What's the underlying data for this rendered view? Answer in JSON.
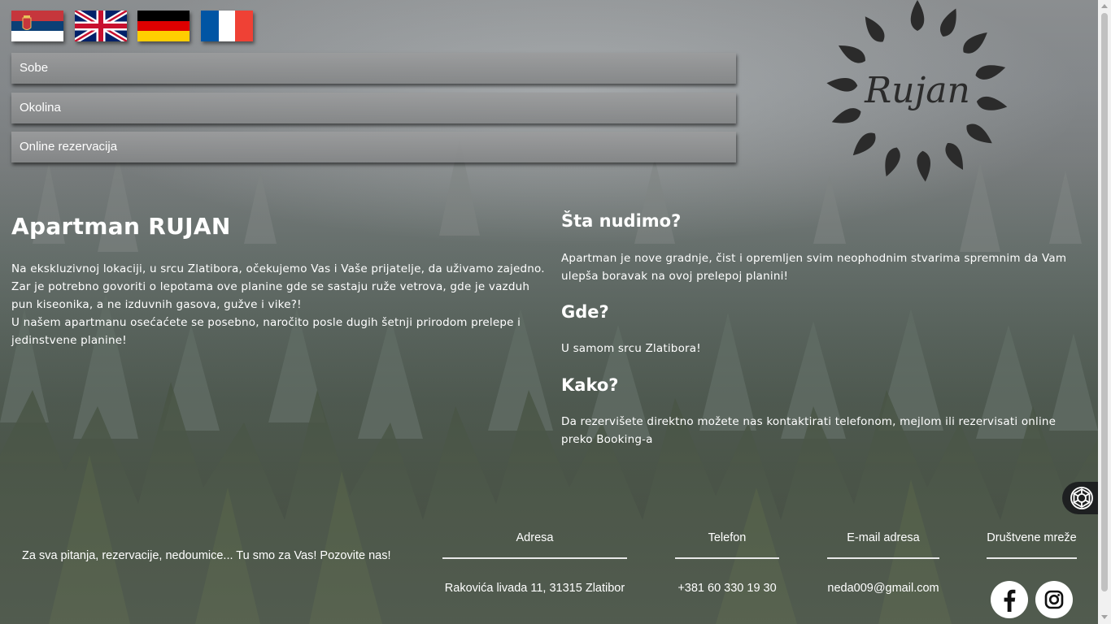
{
  "languages": [
    {
      "code": "sr",
      "label": "Srpski"
    },
    {
      "code": "en",
      "label": "English"
    },
    {
      "code": "de",
      "label": "Deutsch"
    },
    {
      "code": "fr",
      "label": "Français"
    }
  ],
  "menu": {
    "items": [
      {
        "label": "Sobe"
      },
      {
        "label": "Okolina"
      },
      {
        "label": "Online rezervacija"
      }
    ]
  },
  "logo": {
    "text": "Rujan"
  },
  "intro": {
    "title": "Apartman RUJAN",
    "paragraph_1": "Na ekskluzivnoj lokaciji, u srcu Zlatibora, očekujemo Vas i Vaše prijatelje, da uživamo zajedno. Zar je potrebno govoriti o lepotama ove planine gde se sastaju ruže vetrova, gde je vazduh pun kiseonika, a ne izduvnih gasova, gužve i vike?!",
    "paragraph_2": "U našem apartmanu osećaćete se posebno, naročito posle dugih šetnji prirodom prelepe i jedinstvene planine!"
  },
  "sections": [
    {
      "title": "Šta nudimo?",
      "text": "Apartman je nove gradnje, čist i opremljen svim neophodnim stvarima spremnim da Vam ulepša boravak na ovoj prelepoj planini!"
    },
    {
      "title": "Gde?",
      "text": "U samom srcu Zlatibora!"
    },
    {
      "title": "Kako?",
      "text": "Da rezervišete direktno možete nas kontaktirati telefonom, mejlom ili rezervisati online preko Booking-a"
    }
  ],
  "footer": {
    "tagline": "Za sva pitanja, rezervacije, nedoumice... Tu smo za Vas! Pozovite nas!",
    "address_label": "Adresa",
    "address_value": "Rakovića livada 11, 31315 Zlatibor",
    "phone_label": "Telefon",
    "phone_value": "+381 60 330 19 30",
    "email_label": "E-mail adresa",
    "email_value": "neda009@gmail.com",
    "social_label": "Društvene mreže",
    "social_icons": [
      "facebook-icon",
      "instagram-icon"
    ]
  },
  "colors": {
    "menu_bg": "#919293",
    "text": "#ffffff",
    "logo_dark": "#2b2b2b"
  }
}
